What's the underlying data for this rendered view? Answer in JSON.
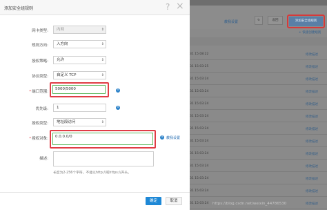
{
  "dialog": {
    "title": "添加安全组规则",
    "help_icon": "?",
    "close_icon": "×",
    "fields": {
      "nic_type": {
        "label": "网卡类型:",
        "value": "内网"
      },
      "direction": {
        "label": "规则方向:",
        "value": "入方向"
      },
      "policy": {
        "label": "授权策略:",
        "value": "允许"
      },
      "protocol": {
        "label": "协议类型:",
        "value": "自定义 TCP"
      },
      "port_range": {
        "label": "端口范围:",
        "value": "5000/5000"
      },
      "priority": {
        "label": "优先级:",
        "value": "1"
      },
      "auth_type": {
        "label": "授权类型:",
        "value": "地址段访问"
      },
      "auth_object": {
        "label": "授权对象:",
        "value": "0.0.0.0/0",
        "tutorial": "教我设置"
      },
      "description": {
        "label": "描述:",
        "hint": "长度为2-256个字符，不能以http://或https://开头。"
      }
    },
    "required_mark": "*",
    "info_glyph": "i",
    "confirm_label": "确定",
    "cancel_label": "取消"
  },
  "background": {
    "tutorial_link": "教我设置",
    "back_button": "返回",
    "add_rule_button": "添加安全组规则",
    "quick_add": "+ 快速创建规则",
    "rows": [
      {
        "time": "31 15:08:22",
        "action": "修改描述"
      },
      {
        "time": "31 15:03:25",
        "action": "修改描述"
      },
      {
        "time": "31 15:03:24",
        "action": "修改描述"
      },
      {
        "time": "31 15:03:24",
        "action": "修改描述"
      },
      {
        "time": "31 15:03:24",
        "action": "修改描述"
      },
      {
        "time": "31 15:03:24",
        "action": "修改描述"
      },
      {
        "time": "31 15:03:24",
        "action": "修改描述"
      },
      {
        "time": "31 15:03:24",
        "action": "修改描述"
      },
      {
        "time": "31 15:03:24",
        "action": "修改描述"
      },
      {
        "time": "31 15:03:24",
        "action": "修改描述"
      },
      {
        "time": "31 15:03:24",
        "action": "修改描述"
      },
      {
        "time": "31 15:03:24",
        "action": "修改描述"
      },
      {
        "time": "31 15:03:24",
        "action": "修改描述"
      }
    ]
  },
  "watermark": "https://blog.csdn.net/weixin_44786530",
  "colors": {
    "highlight_red": "#e03c45",
    "focus_green": "#5cb85c",
    "primary_blue": "#1e88d6"
  }
}
